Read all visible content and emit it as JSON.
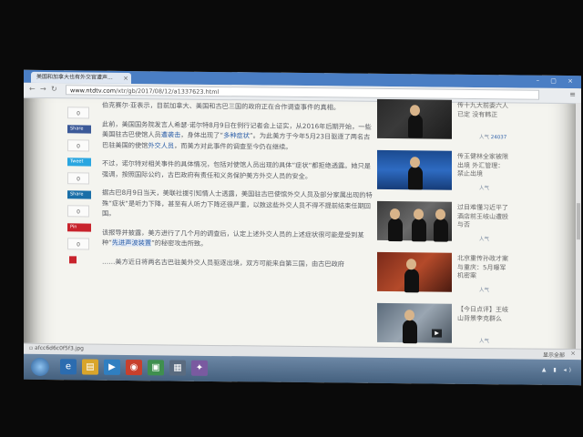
{
  "browser": {
    "tab_title": "美国和加拿大也有外交官遭声...",
    "tab_close": "×",
    "window_controls": "– ▢ ×",
    "nav_back": "←",
    "nav_forward": "→",
    "nav_reload": "↻",
    "url_host": "www.ntdtv.com",
    "url_path": "/xtr/gb/2017/08/12/a1337623.html",
    "menu_icon": "≡"
  },
  "share": {
    "counts": [
      "0",
      "0",
      "0",
      "0",
      "0"
    ],
    "buttons": {
      "facebook": "Share",
      "twitter": "Tweet",
      "linkedin": "Share",
      "pinterest": "Pin"
    }
  },
  "article": {
    "p1": "伯克赛尔·亚表示，目前加拿大、美国和古巴三国的政府正在合作调查事件的真相。",
    "p2a": "此前，美国国务院发言人希瑟·诺尔特8月9日在例行记者会上证实，从2016年后期开始，一些美国驻古巴使馆人员",
    "p2_link1": "遭袭击",
    "p2b": "，身体出现了“",
    "p2_link2": "多种症状",
    "p2c": "”。为此美方于今年5月23日驱逐了两名古巴驻美国的使馆",
    "p2_link3": "外交人员",
    "p2d": "，而美方对此事件的调查至今仍在继续。",
    "p3": "不过，诺尔特对相关事件的具体情况，包括对使馆人员出现的具体“症状”都拒绝透露。她只是强调，按照国际公约，古巴政府有责任和义务保护美方外交人员的安全。",
    "p4": "据古巴8月9日当天，美联社援引知情人士透露，美国驻古巴使馆外交人员及部分家属出现的特殊“症状”是听力下降，甚至有人听力下降还很严重，以致这些外交人员不得不提前结束任期回国。",
    "p5a": "该报导并披露，美方进行了几个月的调查后，认定上述外交人员的上述症状很可能是受到某种“",
    "p5_link": "先进声波装置",
    "p5b": "”的秘密攻击所致。",
    "p6": "……美方近日将两名古巴驻美外交人员驱逐出境，双方可能来自第三国，由古巴政府"
  },
  "sidebar": {
    "items": [
      {
        "title": "传十九大前委六人已定 没有韩正",
        "views": "24037"
      },
      {
        "title": "传王健林全家被限出境 外汇管理：禁止出境",
        "views": ""
      },
      {
        "title": "过目难懂习近平了 酒店前王岐山遭殴与否",
        "views": ""
      },
      {
        "title": "北京重传孙政才案与重庆：5月曝军机密案",
        "views": ""
      },
      {
        "title": "【今日点评】王岐山背景李克群么",
        "views": ""
      }
    ],
    "views_label": "人气"
  },
  "download": {
    "file": "▫ afcc6d6c0f5f3.jpg",
    "show_all": "显示全部",
    "close": "×"
  },
  "taskbar": {
    "tray": "▲ ▮ ◂)"
  },
  "colors": {
    "link": "#2b5ea8",
    "tabbar": "#4a7ec4",
    "taskbar": "#44607e"
  }
}
